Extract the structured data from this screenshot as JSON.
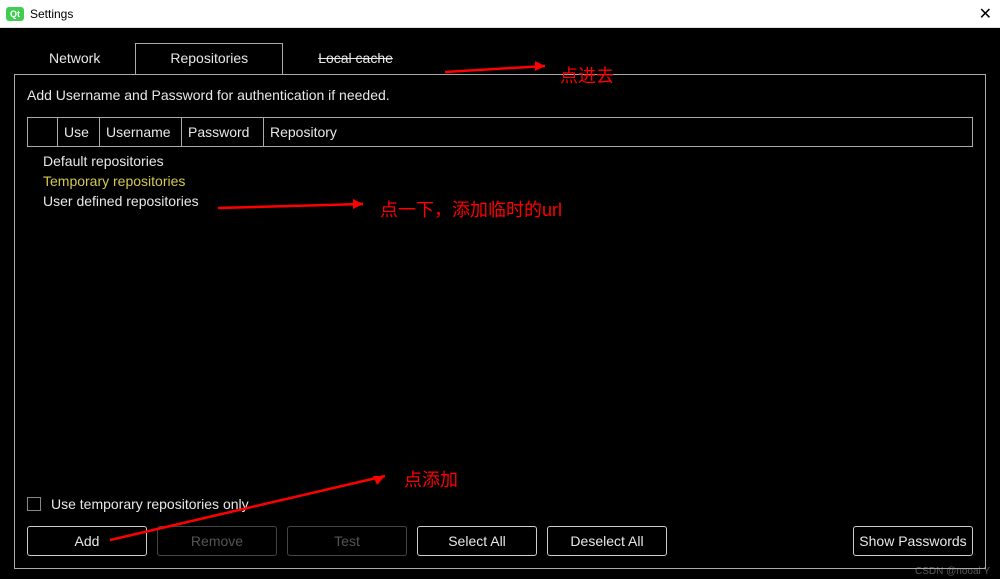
{
  "window": {
    "title": "Settings",
    "logo_text": "Qt"
  },
  "tabs": {
    "network": "Network",
    "repositories": "Repositories",
    "local_cache": "Local cache"
  },
  "content": {
    "instruction": "Add Username and Password for authentication if needed.",
    "headers": {
      "col0": "",
      "col1": "Use",
      "col2": "Username",
      "col3": "Password",
      "col4": "Repository"
    },
    "tree": {
      "default_repos": "Default repositories",
      "temporary_repos": "Temporary repositories",
      "user_defined_repos": "User defined repositories"
    },
    "checkbox_label": "Use temporary repositories only",
    "buttons": {
      "add": "Add",
      "remove": "Remove",
      "test": "Test",
      "select_all": "Select All",
      "deselect_all": "Deselect All",
      "show_passwords": "Show Passwords"
    }
  },
  "annotations": {
    "a1": "点进去",
    "a2": "点一下，添加临时的url",
    "a3": "点添加"
  },
  "watermark": "CSDN @nooal Y"
}
